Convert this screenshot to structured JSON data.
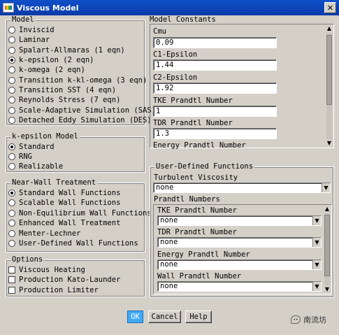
{
  "window": {
    "title": "Viscous Model",
    "close_glyph": "✕"
  },
  "model": {
    "label": "Model",
    "options": [
      {
        "label": "Inviscid",
        "selected": false
      },
      {
        "label": "Laminar",
        "selected": false
      },
      {
        "label": "Spalart-Allmaras (1 eqn)",
        "selected": false
      },
      {
        "label": "k-epsilon (2 eqn)",
        "selected": true
      },
      {
        "label": "k-omega (2 eqn)",
        "selected": false
      },
      {
        "label": "Transition k-kl-omega (3 eqn)",
        "selected": false
      },
      {
        "label": "Transition SST (4 eqn)",
        "selected": false
      },
      {
        "label": "Reynolds Stress (7 eqn)",
        "selected": false
      },
      {
        "label": "Scale-Adaptive Simulation (SAS)",
        "selected": false
      },
      {
        "label": "Detached Eddy Simulation (DES)",
        "selected": false
      }
    ]
  },
  "kepsilon": {
    "label": "k-epsilon Model",
    "options": [
      {
        "label": "Standard",
        "selected": true
      },
      {
        "label": "RNG",
        "selected": false
      },
      {
        "label": "Realizable",
        "selected": false
      }
    ]
  },
  "nearwall": {
    "label": "Near-Wall Treatment",
    "options": [
      {
        "label": "Standard Wall Functions",
        "selected": true
      },
      {
        "label": "Scalable Wall Functions",
        "selected": false
      },
      {
        "label": "Non-Equilibrium Wall Functions",
        "selected": false
      },
      {
        "label": "Enhanced Wall Treatment",
        "selected": false
      },
      {
        "label": "Menter-Lechner",
        "selected": false
      },
      {
        "label": "User-Defined Wall Functions",
        "selected": false
      }
    ]
  },
  "options": {
    "label": "Options",
    "items": [
      {
        "label": "Viscous Heating",
        "checked": false
      },
      {
        "label": "Production Kato-Launder",
        "checked": false
      },
      {
        "label": "Production Limiter",
        "checked": false
      }
    ]
  },
  "constants": {
    "label": "Model Constants",
    "items": [
      {
        "label": "Cmu",
        "value": "0.09"
      },
      {
        "label": "C1-Epsilon",
        "value": "1.44"
      },
      {
        "label": "C2-Epsilon",
        "value": "1.92"
      },
      {
        "label": "TKE Prandtl Number",
        "value": "1"
      },
      {
        "label": "TDR Prandtl Number",
        "value": "1.3"
      }
    ],
    "next_label": "Energy Prandtl Number"
  },
  "udf": {
    "label": "User-Defined Functions",
    "turbulent_viscosity_label": "Turbulent Viscosity",
    "turbulent_viscosity_value": "none",
    "prandtl_label": "Prandtl Numbers",
    "prandtl": [
      {
        "label": "TKE Prandtl Number",
        "value": "none"
      },
      {
        "label": "TDR Prandtl Number",
        "value": "none"
      },
      {
        "label": "Energy Prandtl Number",
        "value": "none"
      },
      {
        "label": "Wall Prandtl Number",
        "value": "none"
      }
    ]
  },
  "buttons": {
    "ok": "OK",
    "cancel": "Cancel",
    "help": "Help"
  },
  "watermark": {
    "text": "南流坊"
  }
}
